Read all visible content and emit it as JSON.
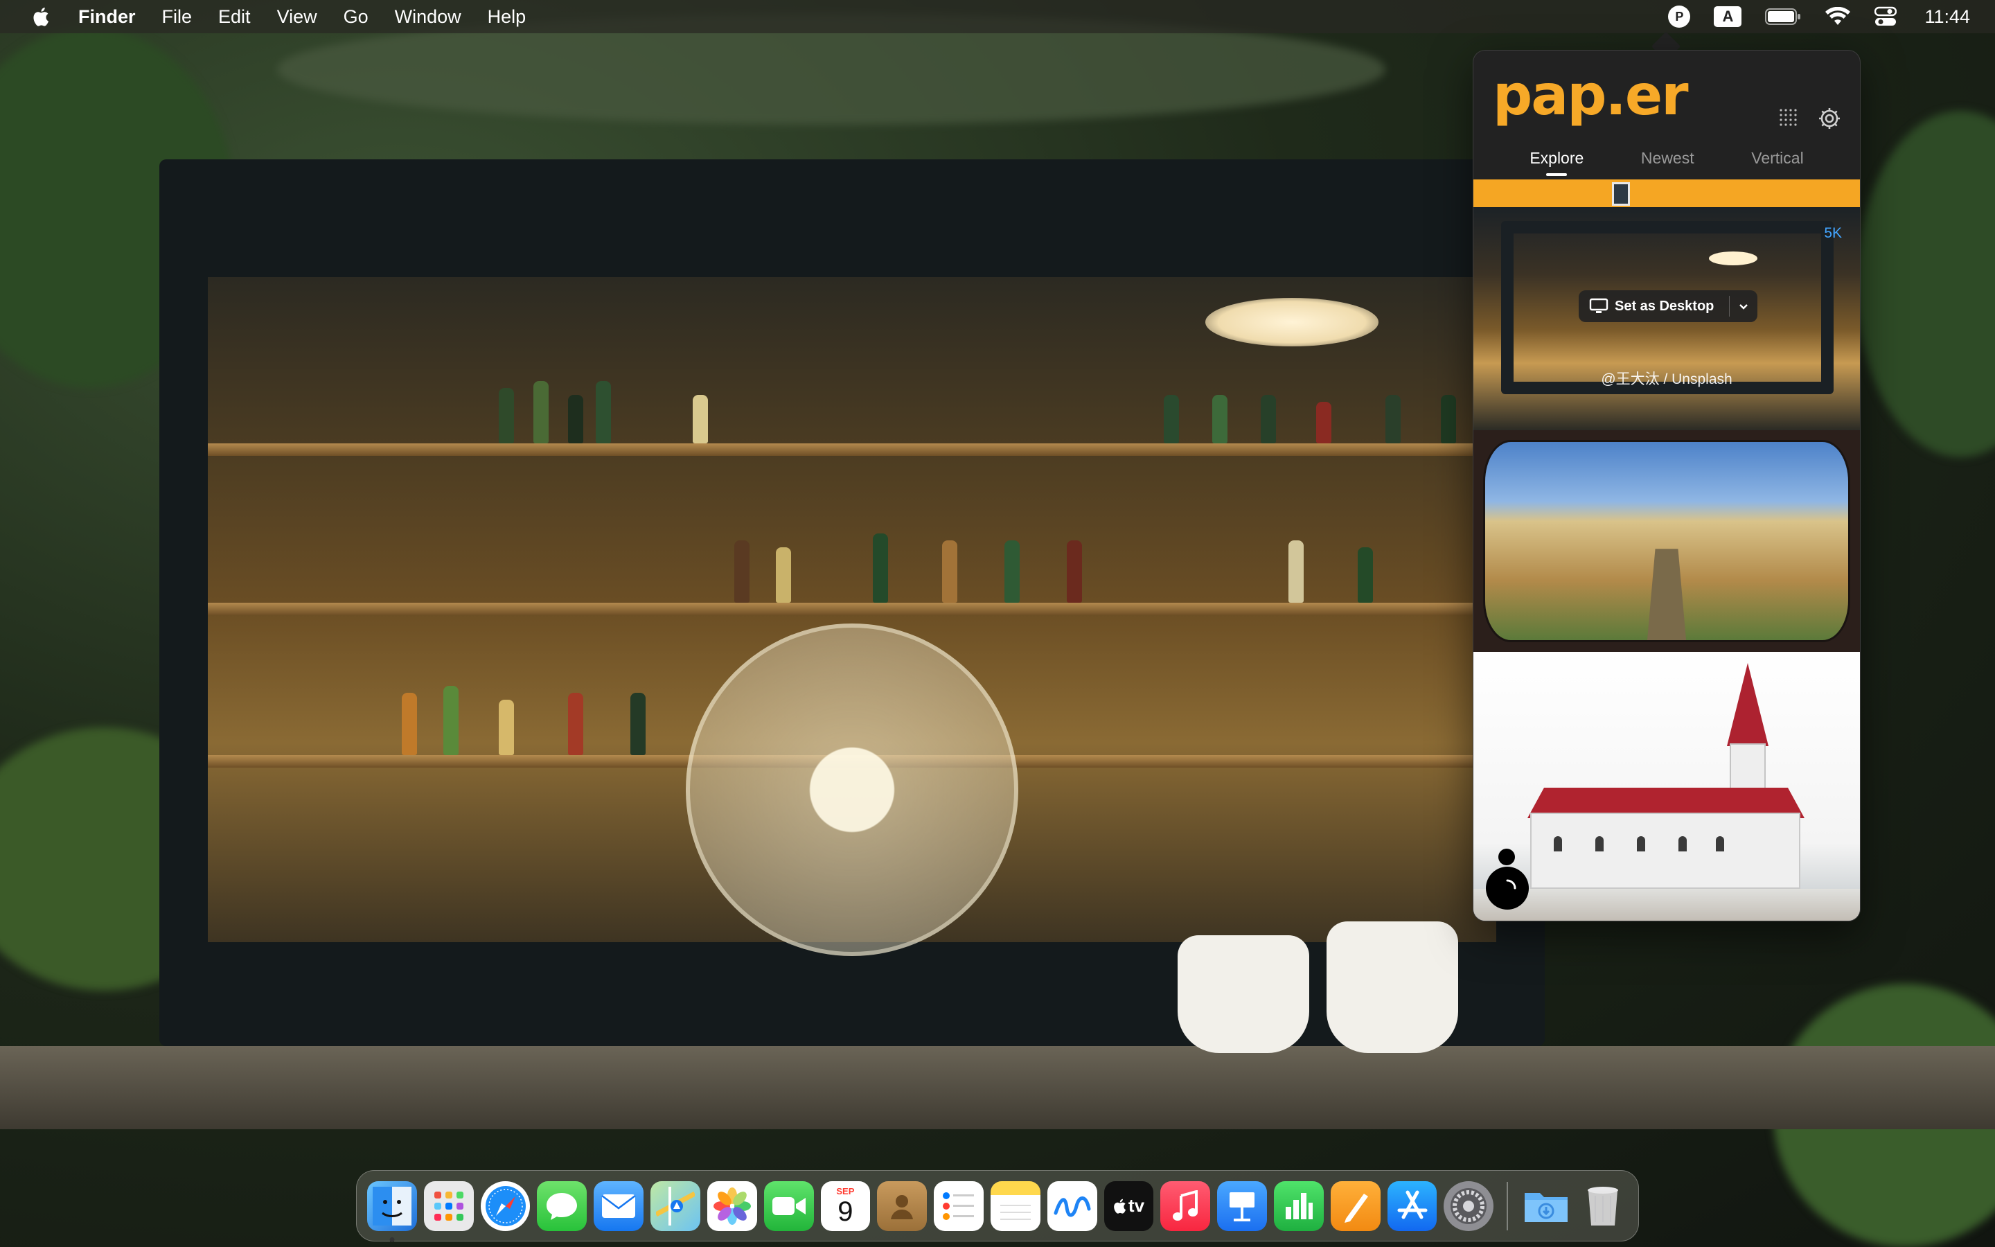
{
  "menubar": {
    "app_name": "Finder",
    "menus": [
      "File",
      "Edit",
      "View",
      "Go",
      "Window",
      "Help"
    ],
    "status": {
      "paper_icon_letter": "P",
      "input_source_letter": "A",
      "clock": "11:44"
    }
  },
  "popover": {
    "logo": "pap.er",
    "tabs": [
      "Explore",
      "Newest",
      "Vertical"
    ],
    "active_tab": "Explore",
    "wallpapers": [
      {
        "badge": "5K",
        "action_label": "Set as Desktop",
        "credit": "@王大汰 / Unsplash"
      }
    ]
  },
  "dock": {
    "calendar_month": "SEP",
    "calendar_day": "9",
    "tv_label": "tv"
  }
}
